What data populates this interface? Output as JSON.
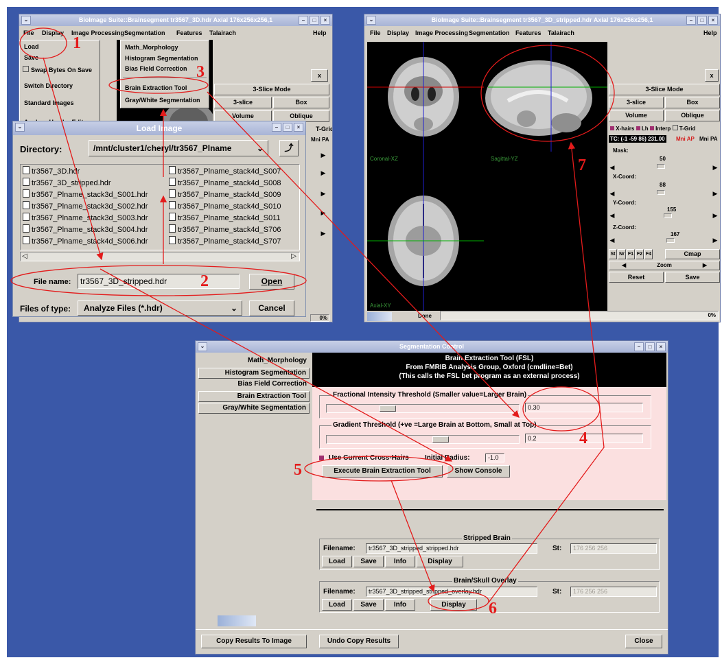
{
  "win1": {
    "title": "BioImage Suite::Brainsegment tr3567_3D.hdr Axial 176x256x256,1",
    "menu": [
      "File",
      "Display",
      "Image Processing",
      "Segmentation",
      "Features",
      "Talairach",
      "Help"
    ],
    "file_menu": [
      "Load",
      "Save",
      "Swap Bytes On Save",
      "Switch Directory",
      "Standard Images",
      "Analyze Header Editor"
    ],
    "seg_menu": [
      "Math_Morphology",
      "Histogram Segmentation",
      "Bias Field Correction",
      "Brain Extraction Tool",
      "Gray/White Segmentation"
    ],
    "buttons": {
      "x": "x",
      "slice_mode": "3-Slice Mode",
      "three_slice": "3-slice",
      "box": "Box",
      "volume": "Volume",
      "oblique": "Oblique",
      "tgrid": "T-Grid",
      "mni_pa": "Mni PA"
    },
    "progress": "0%"
  },
  "load_dialog": {
    "title": "Load Image",
    "directory_label": "Directory:",
    "directory": "/mnt/cluster1/cheryl/tr3567_Plname",
    "files_col1": [
      "tr3567_3D.hdr",
      "tr3567_3D_stripped.hdr",
      "tr3567_Plname_stack3d_S001.hdr",
      "tr3567_Plname_stack3d_S002.hdr",
      "tr3567_Plname_stack3d_S003.hdr",
      "tr3567_Plname_stack3d_S004.hdr",
      "tr3567_Plname_stack4d_S006.hdr"
    ],
    "files_col2": [
      "tr3567_Plname_stack4d_S007",
      "tr3567_Plname_stack4d_S008",
      "tr3567_Plname_stack4d_S009",
      "tr3567_Plname_stack4d_S010",
      "tr3567_Plname_stack4d_S011",
      "tr3567_Plname_stack4d_S706",
      "tr3567_Plname_stack4d_S707"
    ],
    "filename_label": "File name:",
    "filename": "tr3567_3D_stripped.hdr",
    "open": "Open",
    "filetype_label": "Files of type:",
    "filetype": "Analyze Files (*.hdr)",
    "cancel": "Cancel"
  },
  "win2": {
    "title": "BioImage Suite::Brainsegment tr3567_3D_stripped.hdr Axial 176x256x256,1",
    "menu": [
      "File",
      "Display",
      "Image Processing",
      "Segmentation",
      "Features",
      "Talairach",
      "Help"
    ],
    "views": {
      "coronal": "Coronal-XZ",
      "sagittal": "Sagittal-YZ",
      "axial": "Axial-XY"
    },
    "x": "x",
    "slice_mode": "3-Slice Mode",
    "three_slice": "3-slice",
    "box": "Box",
    "volume": "Volume",
    "oblique": "Oblique",
    "xhairs": "X-hairs",
    "lh": "Lh",
    "interp": "Interp",
    "tgrid": "T-Grid",
    "tc": "TC: (-1 -59 86) 231.00",
    "mni_ap": "Mni AP",
    "mni_pa": "Mni PA",
    "mask_label": "Mask:",
    "mask_value": "50",
    "x_label": "X-Coord:",
    "x_value": "88",
    "y_label": "Y-Coord:",
    "y_value": "155",
    "z_label": "Z-Coord:",
    "z_value": "167",
    "small_btns": [
      "St",
      "Nr",
      "F1",
      "F2",
      "F4"
    ],
    "cmap": "Cmap",
    "zoom": "Zoom",
    "reset": "Reset",
    "save": "Save",
    "status": "Done",
    "progress": "0%"
  },
  "seg": {
    "title": "Segmentation Control",
    "sidebar": [
      "Math_Morphology",
      "Histogram Segmentation",
      "Bias Field Correction",
      "Brain Extraction Tool",
      "Gray/White Segmentation"
    ],
    "header": [
      "Brain Extraction Tool  (FSL)",
      "From FMRIB Analysis Group, Oxford (cmdline=Bet)",
      "(This calls the FSL bet program as an external process)"
    ],
    "fit_label": "Fractional Intensity Threshold (Smaller value=Larger Brain)",
    "fit_value": "0.30",
    "fit_level": 0.3,
    "grad_label": "Gradient Threshold (+ve =Large Brain at Bottom, Small at Top)",
    "grad_value": "0.2",
    "grad_level": 0.6,
    "use_cross": "Use Current Cross-Hairs",
    "radius_label": "Initial Radius:",
    "radius_value": "-1.0",
    "execute": "Execute Brain Extraction Tool",
    "console": "Show Console",
    "stripped_title": "Stripped Brain",
    "filename_label": "Filename:",
    "stripped_file": "tr3567_3D_stripped_stripped.hdr",
    "st_label": "St:",
    "st_value": "176 256 256",
    "overlay_title": "Brain/Skull Overlay",
    "overlay_file": "tr3567_3D_stripped_stripped_overlay.hdr",
    "buttons": [
      "Load",
      "Save",
      "Info",
      "Display"
    ],
    "copy": "Copy Results To Image",
    "undo": "Undo Copy Results",
    "close": "Close"
  },
  "annotations": [
    "1",
    "2",
    "3",
    "4",
    "5",
    "6",
    "7"
  ],
  "colors": {
    "desktop": "#3a58a8",
    "annotation": "#e31b1b",
    "panel": "#d4d0c8",
    "pink": "#fbe0e0",
    "highlight": "#d41c1c"
  }
}
